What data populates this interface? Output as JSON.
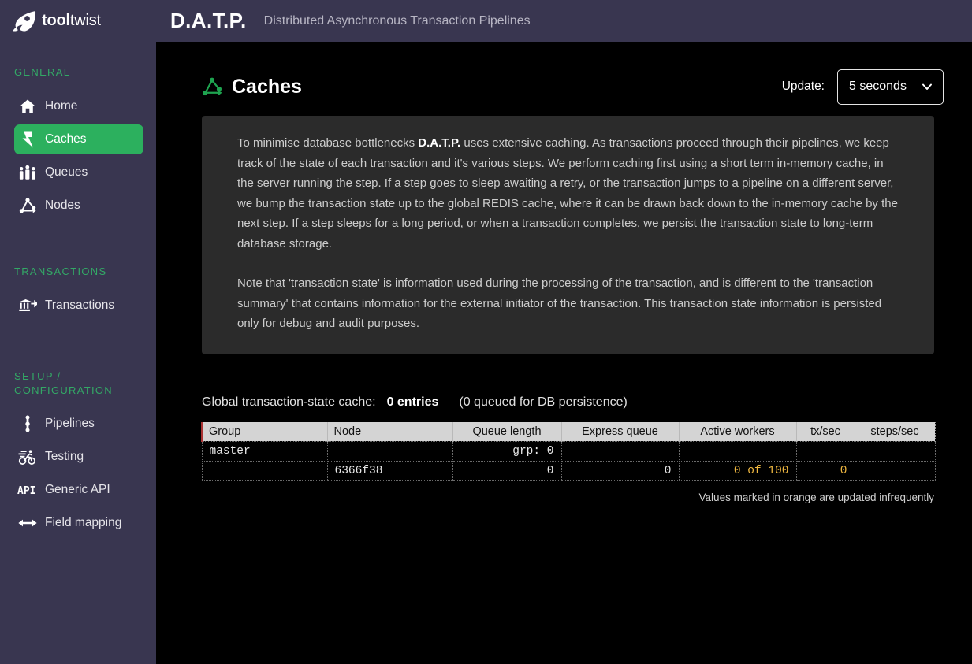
{
  "header": {
    "logo_text_bold": "tool",
    "logo_text_light": "twist",
    "logo_icon": "flame-rocket-icon",
    "brand_abbrev": "D.A.T.P.",
    "brand_full": "Distributed Asynchronous Transaction Pipelines",
    "background_color": "#393650"
  },
  "sidebar": {
    "background_color": "#393650",
    "heading_color": "#33a866",
    "active_color": "#2cb05e",
    "sections": [
      {
        "heading": "GENERAL",
        "items": [
          {
            "label": "Home",
            "icon": "home-icon",
            "active": false
          },
          {
            "label": "Caches",
            "icon": "lightning-bolt-icon",
            "active": true
          },
          {
            "label": "Queues",
            "icon": "people-queue-icon",
            "active": false
          },
          {
            "label": "Nodes",
            "icon": "nodes-graph-icon",
            "active": false
          }
        ]
      },
      {
        "heading": "TRANSACTIONS",
        "items": [
          {
            "label": "Transactions",
            "icon": "bank-transfer-icon",
            "active": false
          }
        ]
      },
      {
        "heading": "SETUP / CONFIGURATION",
        "heading_line1": "SETUP /",
        "heading_line2": "CONFIGURATION",
        "items": [
          {
            "label": "Pipelines",
            "icon": "pipeline-dots-icon",
            "active": false
          },
          {
            "label": "Testing",
            "icon": "cyclist-icon",
            "active": false
          },
          {
            "label": "Generic API",
            "icon": "api-text-icon",
            "active": false
          },
          {
            "label": "Field mapping",
            "icon": "double-arrow-icon",
            "active": false
          }
        ]
      }
    ]
  },
  "page": {
    "title": "Caches",
    "title_icon": "nodes-graph-icon",
    "title_icon_color": "#1ea34f",
    "update_label": "Update:",
    "update_selected": "5 seconds",
    "update_options": [
      "5 seconds"
    ],
    "chevron_icon": "chevron-down-icon"
  },
  "info": {
    "paragraph1_pre": "To minimise database bottlenecks ",
    "paragraph1_bold": "D.A.T.P.",
    "paragraph1_post": " uses extensive caching. As transactions proceed through their pipelines, we keep track of the state of each transaction and it's various steps. We perform caching first using a short term in-memory cache, in the server running the step. If a step goes to sleep awaiting a retry, or the transaction jumps to a pipeline on a different server, we bump the transaction state up to the global REDIS cache, where it can be drawn back down to the in-memory cache by the next step. If a step sleeps for a long period, or when a transaction completes, we persist the transaction state to long-term database storage.",
    "paragraph2": "Note that 'transaction state' is information used during the processing of the transaction, and is different to the 'transaction summary' that contains information for the external initiator of the transaction. This transaction state information is persisted only for debug and audit purposes."
  },
  "cache_summary": {
    "label": "Global transaction-state cache:",
    "entries": "0 entries",
    "queued": "(0 queued for DB persistence)"
  },
  "table": {
    "columns": [
      "Group",
      "Node",
      "Queue length",
      "Express queue",
      "Active workers",
      "tx/sec",
      "steps/sec"
    ],
    "rows": [
      {
        "group": "master",
        "node": "",
        "queue_length": "grp: 0",
        "express_queue": "",
        "active_workers": "",
        "tx_sec": "",
        "steps_sec": ""
      },
      {
        "group": "",
        "node": "6366f38",
        "queue_length": "0",
        "express_queue": "0",
        "active_workers": "0 of 100",
        "tx_sec": "0",
        "steps_sec": ""
      }
    ],
    "note": "Values marked in orange are updated infrequently",
    "orange_color": "#f0b840"
  }
}
